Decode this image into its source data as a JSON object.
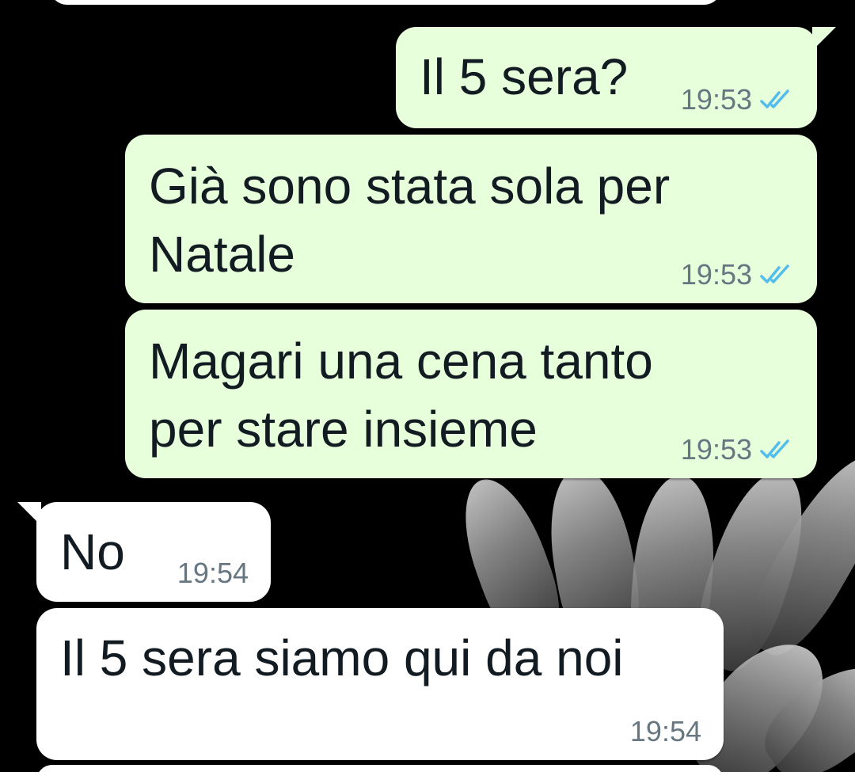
{
  "chat": {
    "messages": [
      {
        "direction": "outgoing",
        "text": "Il 5 sera?",
        "time": "19:53",
        "status": "read"
      },
      {
        "direction": "outgoing",
        "text": "Già sono stata sola per\nNatale",
        "time": "19:53",
        "status": "read"
      },
      {
        "direction": "outgoing",
        "text": "Magari una cena tanto\nper stare insieme",
        "time": "19:53",
        "status": "read"
      },
      {
        "direction": "incoming",
        "text": "No",
        "time": "19:54"
      },
      {
        "direction": "incoming",
        "text": "Il 5 sera siamo qui da noi",
        "time": "19:54"
      }
    ]
  },
  "colors": {
    "outgoing_bubble": "#e7ffdb",
    "incoming_bubble": "#ffffff",
    "read_checkmark": "#53bdeb",
    "timestamp": "#667781",
    "background": "#000000"
  },
  "icons": {
    "read_receipt": "double-check-icon"
  }
}
